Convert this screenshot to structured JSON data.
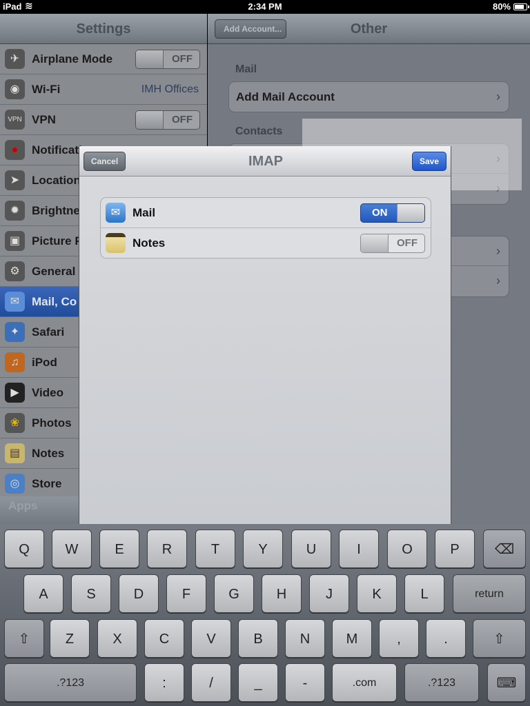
{
  "status_bar": {
    "carrier": "iPad",
    "time": "2:34 PM",
    "battery": "80%"
  },
  "sidebar": {
    "title": "Settings",
    "items": [
      {
        "label": "Airplane Mode",
        "icon": "airplane-icon",
        "glyph": "✈",
        "switch": "OFF"
      },
      {
        "label": "Wi-Fi",
        "icon": "wifi-icon",
        "glyph": "◉",
        "value": "IMH Offices"
      },
      {
        "label": "VPN",
        "icon": "vpn-icon",
        "glyph": "VPN",
        "switch": "OFF"
      },
      {
        "label": "Notificati",
        "icon": "notifications-icon",
        "glyph": "●"
      },
      {
        "label": "Location",
        "icon": "location-icon",
        "glyph": "➤"
      },
      {
        "label": "Brightne",
        "icon": "brightness-icon",
        "glyph": "✹"
      },
      {
        "label": "Picture F",
        "icon": "picture-frame-icon",
        "glyph": "▣"
      },
      {
        "label": "General",
        "icon": "gear-icon",
        "glyph": "⚙"
      },
      {
        "label": "Mail, Co",
        "icon": "mail-icon",
        "glyph": "✉",
        "selected": true
      },
      {
        "label": "Safari",
        "icon": "safari-icon",
        "glyph": "✦"
      },
      {
        "label": "iPod",
        "icon": "ipod-icon",
        "glyph": "♫"
      },
      {
        "label": "Video",
        "icon": "video-icon",
        "glyph": "▶"
      },
      {
        "label": "Photos",
        "icon": "photos-icon",
        "glyph": "❀"
      },
      {
        "label": "Notes",
        "icon": "notes-icon",
        "glyph": "▤"
      },
      {
        "label": "Store",
        "icon": "store-icon",
        "glyph": "◎"
      }
    ],
    "apps_header": "Apps"
  },
  "right_pane": {
    "back_label": "Add Account...",
    "title": "Other",
    "mail_section": "Mail",
    "add_mail_account": "Add Mail Account",
    "contacts_section": "Contacts",
    "chevron": "›"
  },
  "modal": {
    "title": "IMAP",
    "cancel_label": "Cancel",
    "save_label": "Save",
    "rows": [
      {
        "label": "Mail",
        "state": "ON"
      },
      {
        "label": "Notes",
        "state": "OFF"
      }
    ]
  },
  "keyboard": {
    "row1": [
      "Q",
      "W",
      "E",
      "R",
      "T",
      "Y",
      "U",
      "I",
      "O",
      "P"
    ],
    "row2": [
      "A",
      "S",
      "D",
      "F",
      "G",
      "H",
      "J",
      "K",
      "L"
    ],
    "row3": [
      "Z",
      "X",
      "C",
      "V",
      "B",
      "N",
      "M",
      ",",
      "."
    ],
    "return": "return",
    "backspace_glyph": "⌫",
    "shift_glyph": "⇧",
    "numbers": ".?123",
    "colon": ":",
    "slash": "/",
    "underscore": "_",
    "dash": "-",
    "dotcom": ".com",
    "hide_glyph": "⌨"
  }
}
